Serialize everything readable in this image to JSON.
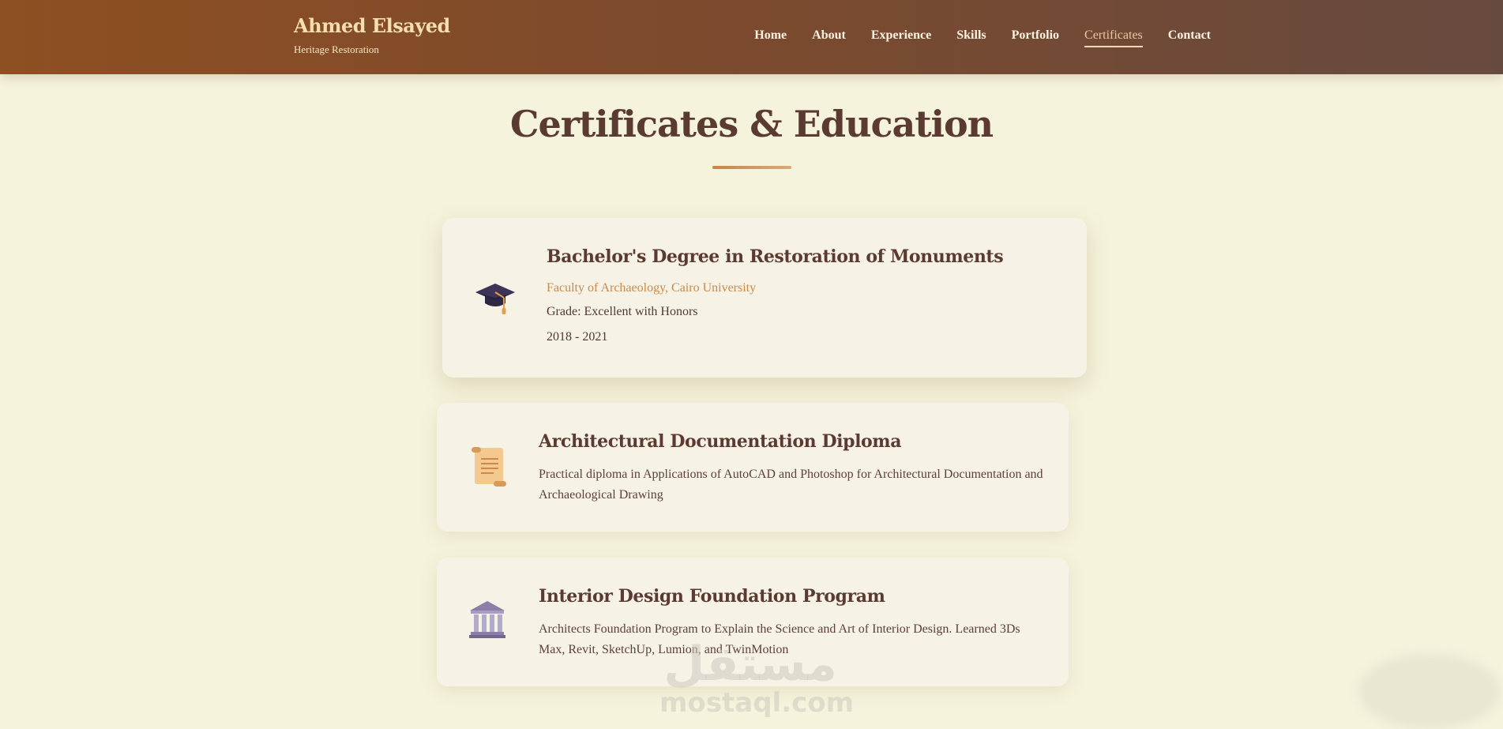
{
  "brand": {
    "name": "Ahmed Elsayed",
    "tagline": "Heritage Restoration"
  },
  "nav": [
    {
      "label": "Home",
      "active": false
    },
    {
      "label": "About",
      "active": false
    },
    {
      "label": "Experience",
      "active": false
    },
    {
      "label": "Skills",
      "active": false
    },
    {
      "label": "Portfolio",
      "active": false
    },
    {
      "label": "Certificates",
      "active": true
    },
    {
      "label": "Contact",
      "active": false
    }
  ],
  "page": {
    "title": "Certificates & Education"
  },
  "certificates": [
    {
      "icon": "graduation-cap-icon",
      "title": "Bachelor's Degree in Restoration of Monuments",
      "institution": "Faculty of Archaeology, Cairo University",
      "grade": "Grade: Excellent with Honors",
      "years": "2018 - 2021"
    },
    {
      "icon": "scroll-icon",
      "title": "Architectural Documentation Diploma",
      "description": "Practical diploma in Applications of AutoCAD and Photoshop for Architectural Documentation and Archaeological Drawing"
    },
    {
      "icon": "classical-building-icon",
      "title": "Interior Design Foundation Program",
      "description": "Architects Foundation Program to Explain the Science and Art of Interior Design. Learned 3Ds Max, Revit, SketchUp, Lumion, and TwinMotion"
    }
  ],
  "watermark": {
    "arabic": "مستقل",
    "domain": "mostaql.com"
  },
  "colors": {
    "header_start": "#8e4f22",
    "header_end": "#674a3f",
    "page_background": "#f5f3dc",
    "card_background": "#f6f2e6",
    "heading": "#5b3a31",
    "accent": "#c98a4a"
  }
}
